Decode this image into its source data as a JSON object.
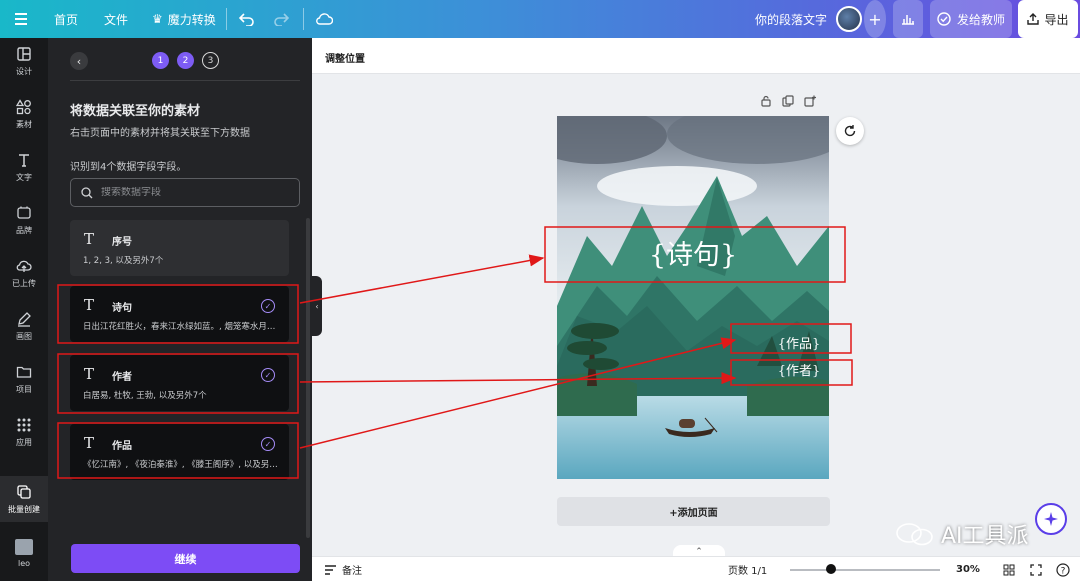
{
  "topbar": {
    "home": "首页",
    "file": "文件",
    "magic_switch": "魔力转换",
    "doc_title": "你的段落文字",
    "share_teacher": "发给教师",
    "export": "导出"
  },
  "rail": [
    {
      "label": "设计",
      "icon": "layout-icon"
    },
    {
      "label": "素材",
      "icon": "shapes-icon"
    },
    {
      "label": "文字",
      "icon": "text-icon"
    },
    {
      "label": "品牌",
      "icon": "brand-icon"
    },
    {
      "label": "已上传",
      "icon": "upload-icon"
    },
    {
      "label": "画图",
      "icon": "draw-icon"
    },
    {
      "label": "项目",
      "icon": "folder-icon"
    },
    {
      "label": "应用",
      "icon": "apps-icon"
    },
    {
      "label": "批量创建",
      "icon": "bulk-create-icon"
    },
    {
      "label": "leo",
      "icon": "avatar"
    }
  ],
  "panel": {
    "steps": [
      "1",
      "2",
      "3"
    ],
    "title": "将数据关联至你的素材",
    "subtitle": "右击页面中的素材并将其关联至下方数据",
    "found": "识别到4个数据字段字段。",
    "search_placeholder": "搜索数据字段",
    "fields": [
      {
        "name": "序号",
        "desc": "1, 2, 3, 以及另外7个",
        "linked": false
      },
      {
        "name": "诗句",
        "desc": "日出江花红胜火，春来江水绿如蓝。, 烟笼寒水月笼沙",
        "linked": true
      },
      {
        "name": "作者",
        "desc": "白居易, 杜牧, 王勃, 以及另外7个",
        "linked": true
      },
      {
        "name": "作品",
        "desc": "《忆江南》, 《夜泊秦淮》, 《滕王阁序》, 以及另外7个",
        "linked": true
      }
    ],
    "continue": "继续"
  },
  "canvas": {
    "header": "调整位置",
    "placeholder_poem": "{诗句}",
    "placeholder_work": "{作品}",
    "placeholder_author": "{作者}",
    "add_page": "+添加页面"
  },
  "bottombar": {
    "notes": "备注",
    "page_count": "页数 1/1",
    "zoom": "30%",
    "zoom_fraction": 0.3
  },
  "watermark": "AI工具派",
  "colors": {
    "accent": "#7d4cf5",
    "annotation": "#e01818",
    "panel_bg": "#232427"
  }
}
